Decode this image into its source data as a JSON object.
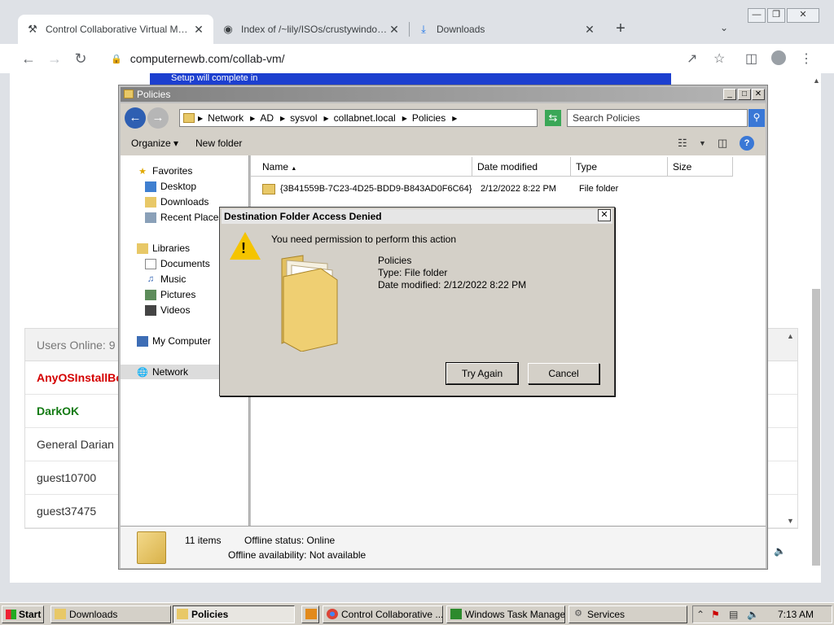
{
  "browser": {
    "tabs": [
      {
        "title": "Control Collaborative Virtual Machin",
        "icon": "collabvm-icon"
      },
      {
        "title": "Index of /~lily/ISOs/crustywindows/",
        "icon": "github-icon"
      },
      {
        "title": "Downloads",
        "icon": "download-icon"
      }
    ],
    "url": "computernewb.com/collab-vm/"
  },
  "page": {
    "vm_banner": "Setup will complete in",
    "users_online": "Users Online: 9",
    "users": [
      {
        "name": "AnyOSInstallBot",
        "role": "admin"
      },
      {
        "name": "DarkOK",
        "role": "mod"
      },
      {
        "name": "General Darian",
        "role": "user"
      },
      {
        "name": "guest10700",
        "role": "user"
      },
      {
        "name": "guest37475",
        "role": "user"
      }
    ]
  },
  "explorer": {
    "title": "Policies",
    "breadcrumb": [
      "Network",
      "AD",
      "sysvol",
      "collabnet.local",
      "Policies"
    ],
    "search_placeholder": "Search Policies",
    "organize_label": "Organize",
    "new_folder_label": "New folder",
    "nav": {
      "favorites": "Favorites",
      "desktop": "Desktop",
      "downloads": "Downloads",
      "recent": "Recent Places",
      "libraries": "Libraries",
      "documents": "Documents",
      "music": "Music",
      "pictures": "Pictures",
      "videos": "Videos",
      "computer": "My Computer",
      "network": "Network"
    },
    "columns": {
      "name": "Name",
      "date": "Date modified",
      "type": "Type",
      "size": "Size"
    },
    "files": [
      {
        "name": "{3B41559B-7C23-4D25-BDD9-B843AD0F6C64}",
        "date": "2/12/2022 8:22 PM",
        "type": "File folder"
      }
    ],
    "details": {
      "items": "11 items",
      "offline_status": "Offline status: Online",
      "offline_availability": "Offline availability: Not available"
    }
  },
  "dialog": {
    "title": "Destination Folder Access Denied",
    "message": "You need permission to perform this action",
    "folder_name": "Policies",
    "folder_type": "Type: File folder",
    "folder_date": "Date modified: 2/12/2022 8:22 PM",
    "try_again": "Try Again",
    "cancel": "Cancel"
  },
  "taskbar": {
    "start": "Start",
    "items": [
      "Downloads",
      "Policies",
      "Control Collaborative ...",
      "Windows Task Manager",
      "Services"
    ],
    "clock": "7:13 AM"
  },
  "colors": {
    "admin": "#d40000",
    "mod": "#137a13",
    "banner": "#1c3fcf"
  }
}
